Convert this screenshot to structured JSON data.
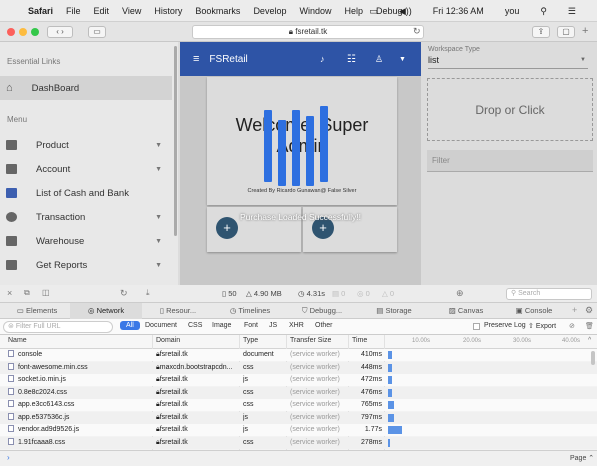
{
  "menubar": {
    "app": "Safari",
    "items": [
      "File",
      "Edit",
      "View",
      "History",
      "Bookmarks",
      "Develop",
      "Window",
      "Help",
      "Debug"
    ],
    "clock": "Fri 12:36 AM",
    "user": "you"
  },
  "browser": {
    "url": "fsretail.tk"
  },
  "sidebar": {
    "section1": "Essential Links",
    "dashboard": "DashBoard",
    "section2": "Menu",
    "items": [
      {
        "label": "Product",
        "icon": "folder-icon",
        "has_chevron": true
      },
      {
        "label": "Account",
        "icon": "account-box-icon",
        "has_chevron": true
      },
      {
        "label": "List of Cash and Bank",
        "icon": "list-icon",
        "has_chevron": false
      },
      {
        "label": "Transaction",
        "icon": "dollar-icon",
        "has_chevron": true
      },
      {
        "label": "Warehouse",
        "icon": "warehouse-icon",
        "has_chevron": true
      },
      {
        "label": "Get Reports",
        "icon": "report-icon",
        "has_chevron": true
      }
    ]
  },
  "app": {
    "brand": "FSRetail",
    "welcome_line1": "Welcome, Super",
    "welcome_line2": "Admin",
    "credit": "Created By Ricardo Gunawan@ False Silver",
    "toast": "Purchase Loaded Successfully!!",
    "fab_label": "+"
  },
  "right_panel": {
    "workspace_label": "Workspace Type",
    "workspace_value": "list",
    "dropzone": "Drop or Click",
    "filter_placeholder": "Filter"
  },
  "devtools": {
    "summary": {
      "requests": "50",
      "size": "4.90 MB",
      "time": "4.31s",
      "c1": "0",
      "c2": "0",
      "c3": "0"
    },
    "search_placeholder": "Search",
    "tabs": [
      "Elements",
      "Network",
      "Resour...",
      "Timelines",
      "Debugg...",
      "Storage",
      "Canvas",
      "Console"
    ],
    "filter_placeholder": "Filter Full URL",
    "filters": [
      "All",
      "Document",
      "CSS",
      "Image",
      "Font",
      "JS",
      "XHR",
      "Other"
    ],
    "preserve_log": "Preserve Log",
    "export": "Export",
    "columns": [
      "Name",
      "Domain",
      "Type",
      "Transfer Size",
      "Time"
    ],
    "timeline_ticks": [
      "10.00s",
      "20.00s",
      "30.00s",
      "40.00s"
    ],
    "rows": [
      {
        "name": "console",
        "domain": "fsretail.tk",
        "type": "document",
        "transfer": "(service worker)",
        "time": "410ms",
        "bar": 0.02
      },
      {
        "name": "font-awesome.min.css",
        "domain": "maxcdn.bootstrapcdn...",
        "type": "css",
        "transfer": "(service worker)",
        "time": "448ms",
        "bar": 0.02
      },
      {
        "name": "socket.io.min.js",
        "domain": "fsretail.tk",
        "type": "js",
        "transfer": "(service worker)",
        "time": "472ms",
        "bar": 0.02
      },
      {
        "name": "0.8e8c2024.css",
        "domain": "fsretail.tk",
        "type": "css",
        "transfer": "(service worker)",
        "time": "476ms",
        "bar": 0.02
      },
      {
        "name": "app.e3cc6143.css",
        "domain": "fsretail.tk",
        "type": "css",
        "transfer": "(service worker)",
        "time": "765ms",
        "bar": 0.03
      },
      {
        "name": "app.e537536c.js",
        "domain": "fsretail.tk",
        "type": "js",
        "transfer": "(service worker)",
        "time": "797ms",
        "bar": 0.03
      },
      {
        "name": "vendor.ad9d9526.js",
        "domain": "fsretail.tk",
        "type": "js",
        "transfer": "(service worker)",
        "time": "1.77s",
        "bar": 0.07
      },
      {
        "name": "1.91fcaaa8.css",
        "domain": "fsretail.tk",
        "type": "css",
        "transfer": "(service worker)",
        "time": "278ms",
        "bar": 0.01
      }
    ],
    "page_label": "Page"
  },
  "colors": {
    "primary": "#2e54a6",
    "loader": "#2d6fe0",
    "fab": "#2f5470",
    "waterfall": "#5b93e6"
  }
}
